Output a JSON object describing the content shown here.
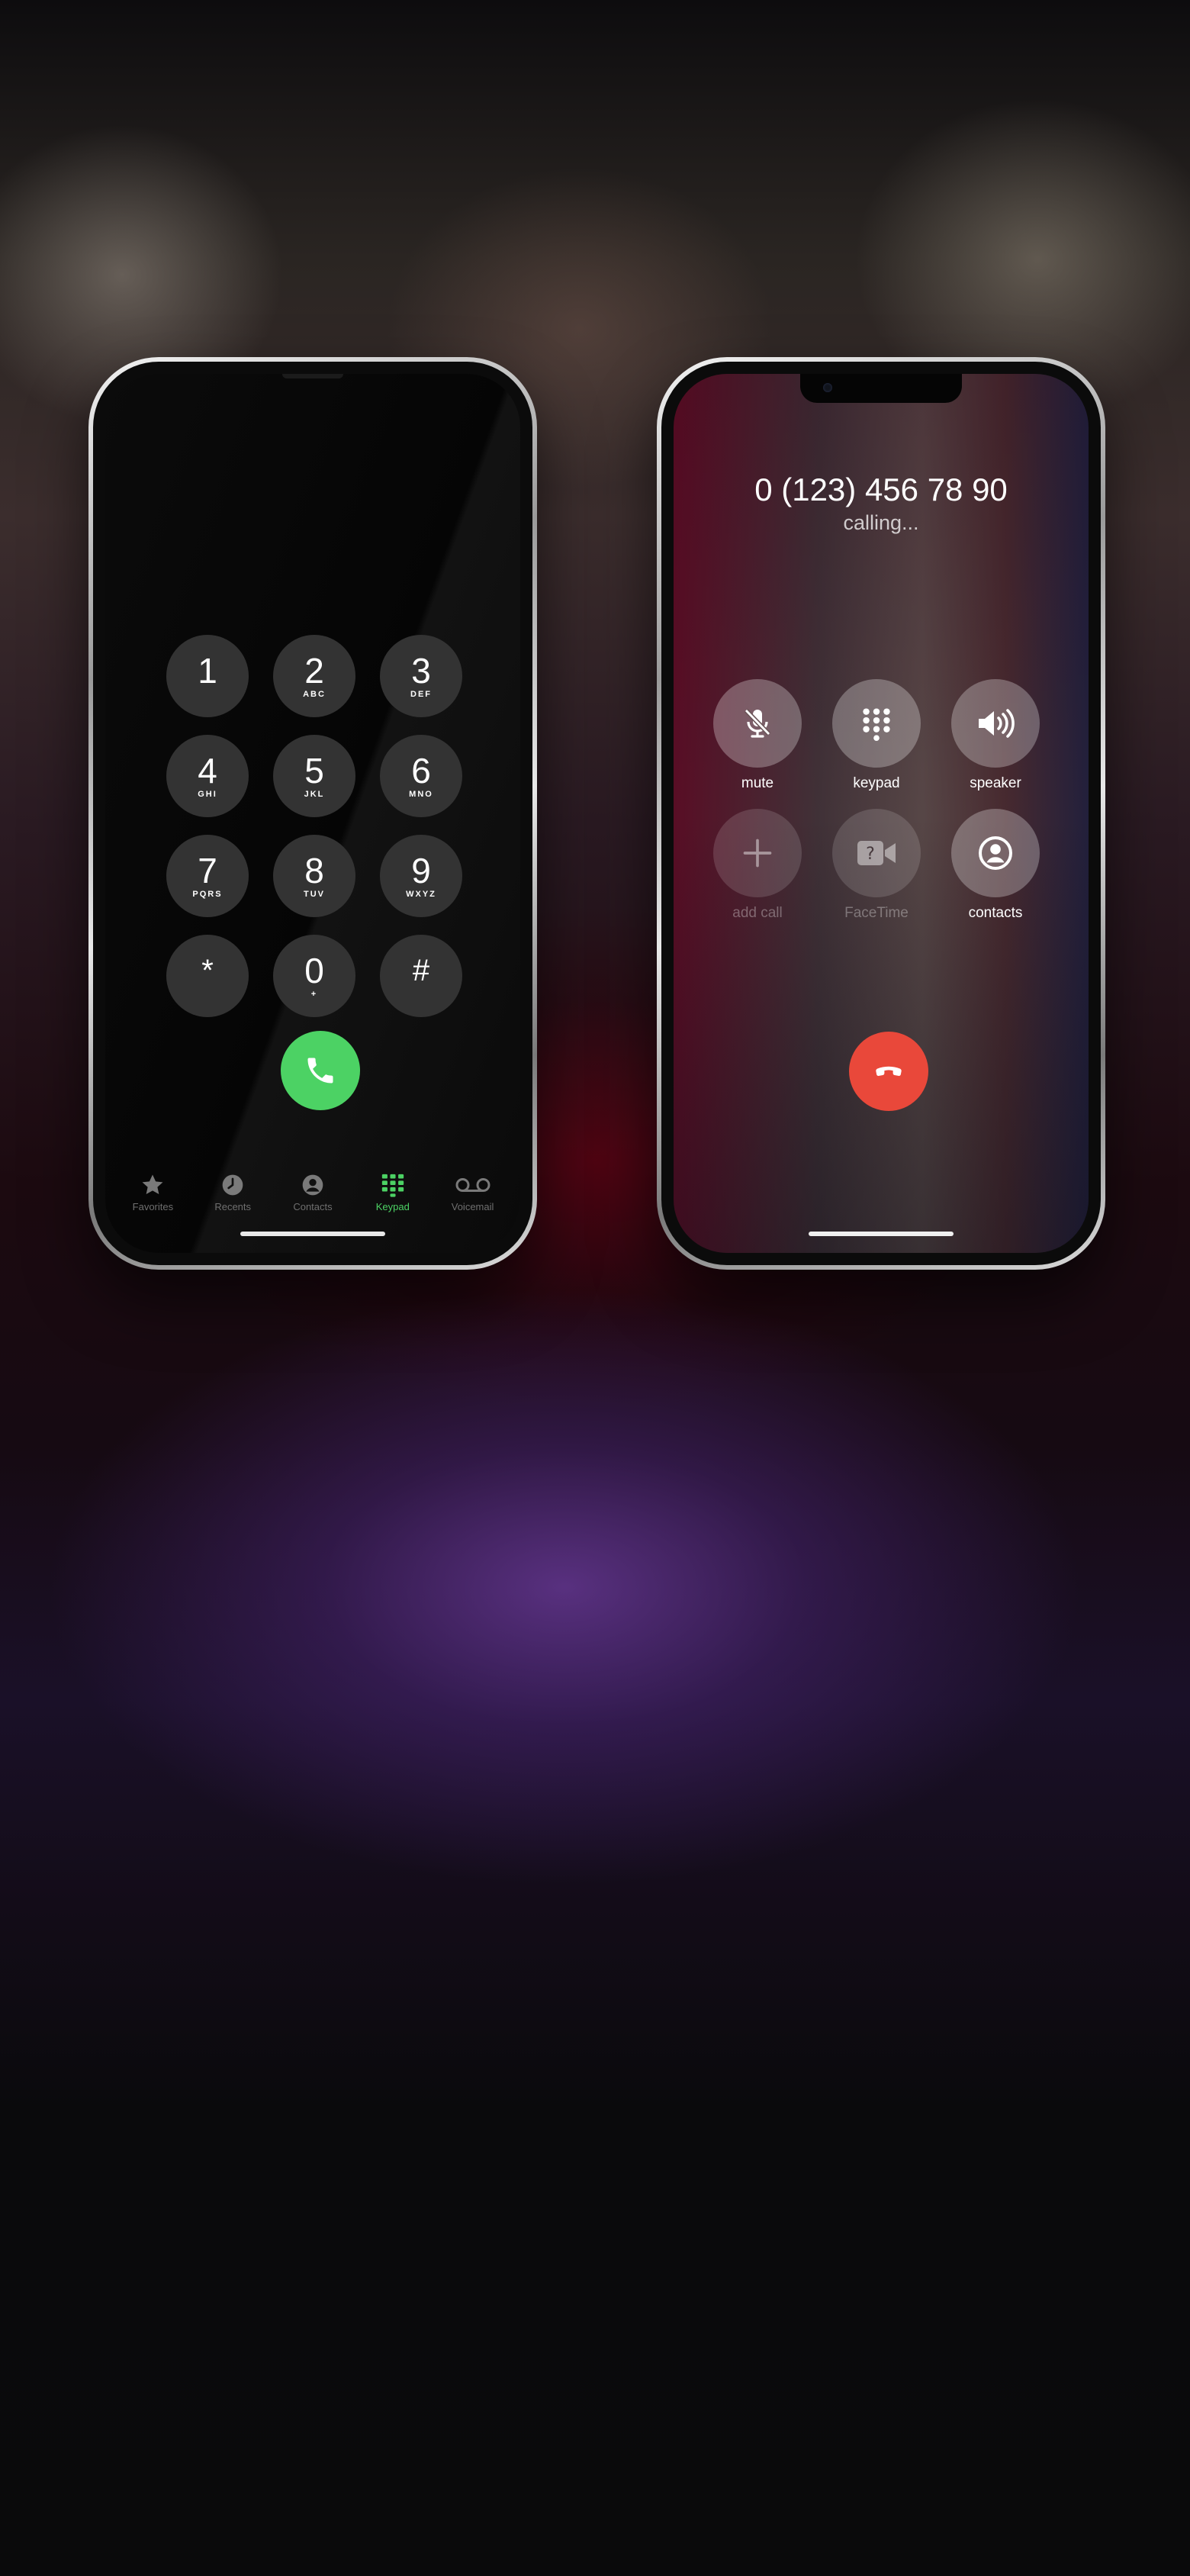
{
  "keypad_screen": {
    "keys": [
      {
        "digit": "1",
        "letters": ""
      },
      {
        "digit": "2",
        "letters": "ABC"
      },
      {
        "digit": "3",
        "letters": "DEF"
      },
      {
        "digit": "4",
        "letters": "GHI"
      },
      {
        "digit": "5",
        "letters": "JKL"
      },
      {
        "digit": "6",
        "letters": "MNO"
      },
      {
        "digit": "7",
        "letters": "PQRS"
      },
      {
        "digit": "8",
        "letters": "TUV"
      },
      {
        "digit": "9",
        "letters": "WXYZ"
      },
      {
        "digit": "*",
        "letters": ""
      },
      {
        "digit": "0",
        "letters": "+"
      },
      {
        "digit": "#",
        "letters": ""
      }
    ],
    "tabs": [
      {
        "label": "Favorites",
        "icon": "star-icon"
      },
      {
        "label": "Recents",
        "icon": "clock-icon"
      },
      {
        "label": "Contacts",
        "icon": "person-circle-icon"
      },
      {
        "label": "Keypad",
        "icon": "keypad-grid-icon"
      },
      {
        "label": "Voicemail",
        "icon": "voicemail-icon"
      }
    ],
    "active_tab": "Keypad",
    "call_button_color": "#4cd264"
  },
  "call_screen": {
    "number": "0 (123) 456 78 90",
    "status": "calling...",
    "controls": [
      {
        "label": "mute",
        "icon": "mic-slash-icon",
        "enabled": true
      },
      {
        "label": "keypad",
        "icon": "keypad-grid-icon",
        "enabled": true
      },
      {
        "label": "speaker",
        "icon": "speaker-icon",
        "enabled": true
      },
      {
        "label": "add call",
        "icon": "plus-icon",
        "enabled": false
      },
      {
        "label": "FaceTime",
        "icon": "video-icon",
        "enabled": false
      },
      {
        "label": "contacts",
        "icon": "person-circle-icon",
        "enabled": true
      }
    ],
    "end_button_color": "#e9483a"
  }
}
